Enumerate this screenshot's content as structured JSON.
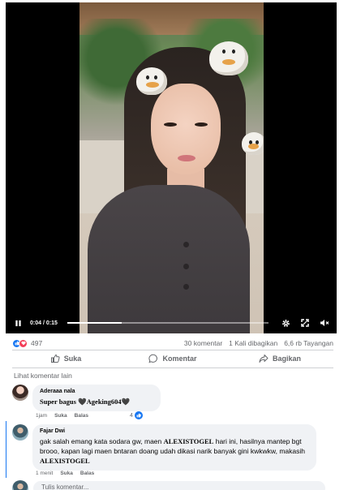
{
  "video": {
    "time": "0:04 / 0:15",
    "progress": 0.27,
    "controls": [
      "pause-icon",
      "settings-icon",
      "fullscreen-icon",
      "volume-mute-icon"
    ]
  },
  "stats": {
    "reaction_count": "497",
    "comments": "30 komentar",
    "shares": "1 Kali dibagikan",
    "views": "6,6 rb Tayangan"
  },
  "actions": {
    "like": "Suka",
    "comment": "Komentar",
    "share": "Bagikan"
  },
  "more_comments": "Lihat komentar lain",
  "comments": [
    {
      "author": "Aderaaa nala",
      "text": "Super bagus 🖤Ageking604🖤",
      "time": "1jam",
      "like": "Suka",
      "reply": "Balas",
      "likes": "4"
    },
    {
      "author": "Fajar Dwi",
      "text_parts": [
        "gak salah emang kata sodara gw, maen ",
        "ALEXISTOGEL",
        " hari ini, hasilnya mantep bgt brooo, kapan lagi maen bntaran doang udah dikasi narik banyak gini kwkwkw, makasih ",
        "ALEXISTOGEL"
      ],
      "time": "1 menit",
      "like": "Suka",
      "reply": "Balas"
    }
  ],
  "composer": {
    "placeholder": "Tulis komentar..."
  },
  "colors": {
    "accent": "#1877f2",
    "love": "#f33e58",
    "muted": "#65676b",
    "bubble": "#f0f2f5"
  }
}
